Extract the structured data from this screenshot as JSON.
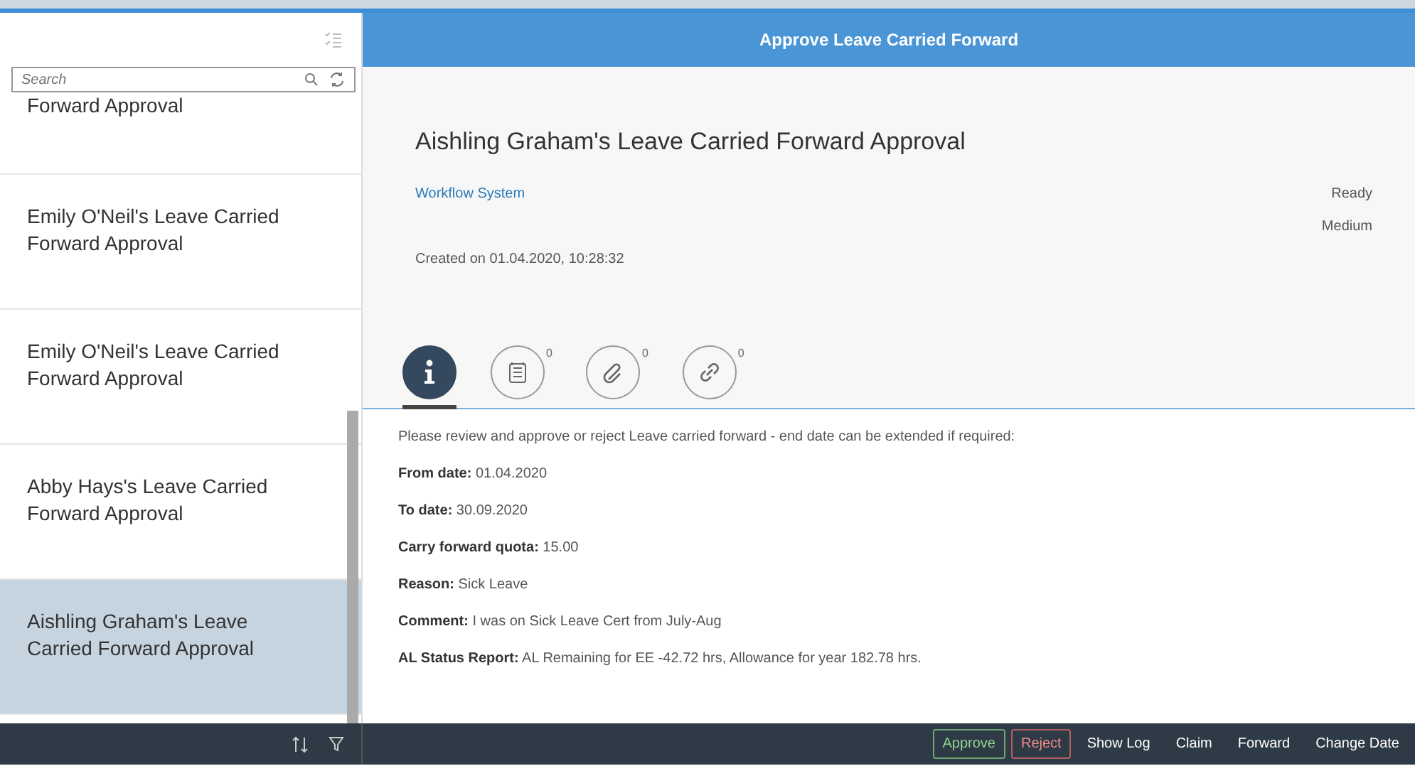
{
  "master": {
    "search": {
      "placeholder": "Search"
    },
    "items": [
      {
        "title": "Forward Approval",
        "selected": false
      },
      {
        "title": "Emily O'Neil's Leave Carried Forward Approval",
        "selected": false
      },
      {
        "title": "Emily O'Neil's Leave Carried Forward Approval",
        "selected": false
      },
      {
        "title": "Abby Hays's Leave Carried Forward Approval",
        "selected": false
      },
      {
        "title": "Aishling Graham's Leave Carried Forward Approval",
        "selected": true
      }
    ]
  },
  "detail": {
    "title": "Approve Leave Carried Forward",
    "header": {
      "title": "Aishling Graham's Leave Carried Forward Approval",
      "created_by": "Workflow System",
      "status": "Ready",
      "priority": "Medium",
      "created_on": "Created on 01.04.2020, 10:28:32"
    },
    "tabs": [
      {
        "kind": "info",
        "selected": true
      },
      {
        "kind": "notes",
        "count": "0",
        "selected": false
      },
      {
        "kind": "attachments",
        "count": "0",
        "selected": false
      },
      {
        "kind": "links",
        "count": "0",
        "selected": false
      }
    ],
    "description": "Please review and approve or reject Leave carried forward - end date can be extended if required:",
    "fields": [
      {
        "label": "From date:",
        "value": "01.04.2020"
      },
      {
        "label": "To date:",
        "value": "30.09.2020"
      },
      {
        "label": "Carry forward quota:",
        "value": "15.00"
      },
      {
        "label": "Reason:",
        "value": "Sick Leave"
      },
      {
        "label": "Comment:",
        "value": "I was on Sick Leave Cert from July-Aug"
      },
      {
        "label": "AL Status Report:",
        "value": "AL Remaining for EE -42.72 hrs, Allowance for year 182.78 hrs."
      }
    ]
  },
  "footer": {
    "actions": [
      {
        "label": "Approve",
        "kind": "accept"
      },
      {
        "label": "Reject",
        "kind": "reject"
      },
      {
        "label": "Show Log",
        "kind": "plain"
      },
      {
        "label": "Claim",
        "kind": "plain"
      },
      {
        "label": "Forward",
        "kind": "plain"
      },
      {
        "label": "Change Date",
        "kind": "plain"
      }
    ]
  }
}
